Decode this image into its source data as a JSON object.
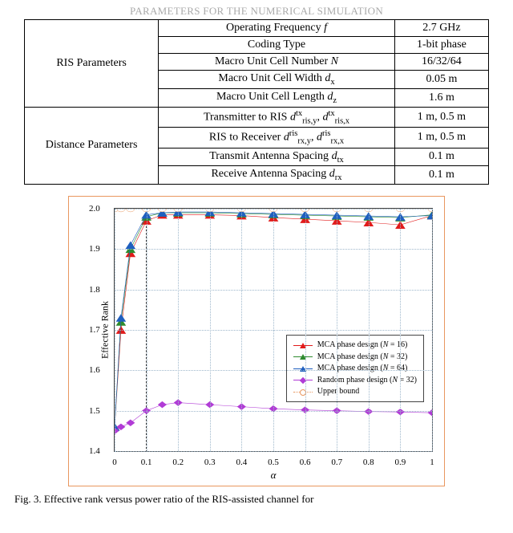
{
  "table": {
    "caption": "PARAMETERS FOR THE NUMERICAL SIMULATION",
    "groups": [
      {
        "header": "RIS Parameters",
        "rows": [
          {
            "param": "Operating Frequency f",
            "param_html": "Operating Frequency <i>f</i>",
            "value": "2.7 GHz"
          },
          {
            "param": "Coding Type",
            "param_html": "Coding Type",
            "value": "1-bit phase"
          },
          {
            "param": "Macro Unit Cell Number N",
            "param_html": "Macro Unit Cell Number <i>N</i>",
            "value": "16/32/64"
          },
          {
            "param": "Macro Unit Cell Width d_x",
            "param_html": "Macro Unit Cell Width <i>d</i><sub>x</sub>",
            "value": "0.05 m"
          },
          {
            "param": "Macro Unit Cell Length d_z",
            "param_html": "Macro Unit Cell Length <i>d</i><sub>z</sub>",
            "value": "1.6 m"
          }
        ]
      },
      {
        "header": "Distance Parameters",
        "rows": [
          {
            "param": "Transmitter to RIS d_ris,y^tx, d_ris,x^tx",
            "param_html": "Transmitter to RIS <i>d</i><sup>tx</sup><sub>ris,y</sub>, <i>d</i><sup>tx</sup><sub>ris,x</sub>",
            "value": "1 m, 0.5 m"
          },
          {
            "param": "RIS to Receiver d_rx,y^ris, d_rx,x^ris",
            "param_html": "RIS to Receiver <i>d</i><sup>ris</sup><sub>rx,y</sub>, <i>d</i><sup>ris</sup><sub>rx,x</sub>",
            "value": "1 m, 0.5 m"
          },
          {
            "param": "Transmit Antenna Spacing d_tx",
            "param_html": "Transmit Antenna Spacing <i>d</i><sub>tx</sub>",
            "value": "0.1 m"
          },
          {
            "param": "Receive Antenna Spacing d_rx",
            "param_html": "Receive Antenna Spacing <i>d</i><sub>rx</sub>",
            "value": "0.1 m"
          }
        ]
      }
    ]
  },
  "chart_data": {
    "type": "line",
    "xlabel": "α",
    "ylabel": "Effective Rank",
    "xlim": [
      0,
      1
    ],
    "ylim": [
      1.4,
      2.0
    ],
    "x": [
      0,
      0.02,
      0.05,
      0.1,
      0.15,
      0.2,
      0.3,
      0.4,
      0.5,
      0.6,
      0.7,
      0.8,
      0.9,
      1.0
    ],
    "vline": 0.1,
    "series": [
      {
        "name": "MCA phase design (N = 16)",
        "color": "#e11b1b",
        "marker": "triangle",
        "values": [
          1.46,
          1.7,
          1.89,
          1.97,
          1.985,
          1.985,
          1.985,
          1.983,
          1.978,
          1.974,
          1.97,
          1.966,
          1.96,
          1.983
        ]
      },
      {
        "name": "MCA phase design (N = 32)",
        "color": "#2e8b2e",
        "marker": "triangle",
        "values": [
          1.46,
          1.72,
          1.9,
          1.98,
          1.99,
          1.99,
          1.99,
          1.988,
          1.986,
          1.984,
          1.982,
          1.98,
          1.978,
          1.985
        ]
      },
      {
        "name": "MCA phase design (N = 64)",
        "color": "#1f5fbf",
        "marker": "triangle",
        "values": [
          1.46,
          1.73,
          1.91,
          1.985,
          1.99,
          1.992,
          1.992,
          1.99,
          1.988,
          1.986,
          1.984,
          1.982,
          1.98,
          1.983
        ]
      },
      {
        "name": "Random phase design (N = 32)",
        "color": "#b13bd6",
        "marker": "diamond",
        "values": [
          1.45,
          1.46,
          1.47,
          1.5,
          1.515,
          1.52,
          1.515,
          1.51,
          1.505,
          1.502,
          1.5,
          1.498,
          1.497,
          1.495
        ]
      },
      {
        "name": "Upper bound",
        "color": "#e9975f",
        "marker": "circle",
        "dashed": true,
        "values": [
          2.0,
          2.0,
          2.0,
          2.0,
          2.0,
          2.0,
          2.0,
          2.0,
          2.0,
          2.0,
          2.0,
          2.0,
          2.0,
          2.0
        ]
      }
    ],
    "xticks": [
      0,
      0.1,
      0.2,
      0.3,
      0.4,
      0.5,
      0.6,
      0.7,
      0.8,
      0.9,
      1.0
    ],
    "yticks": [
      1.4,
      1.5,
      1.6,
      1.7,
      1.8,
      1.9,
      2.0
    ]
  },
  "fig_caption": "Fig. 3.  Effective rank versus power ratio of the RIS-assisted channel for"
}
